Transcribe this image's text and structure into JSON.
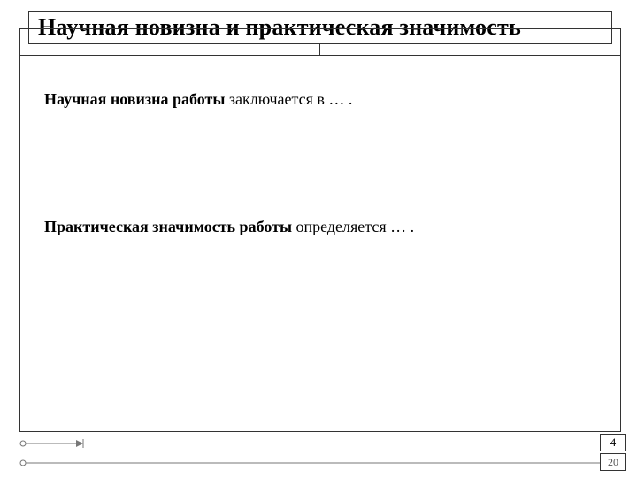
{
  "header": {
    "title": "Научная новизна и практическая значимость"
  },
  "body": {
    "para1_bold": "Научная новизна работы",
    "para1_rest": " заключается в … .",
    "para2_bold": "Практическая значимость работы",
    "para2_rest": " определяется … ."
  },
  "pager": {
    "current": "4",
    "total": "20"
  }
}
